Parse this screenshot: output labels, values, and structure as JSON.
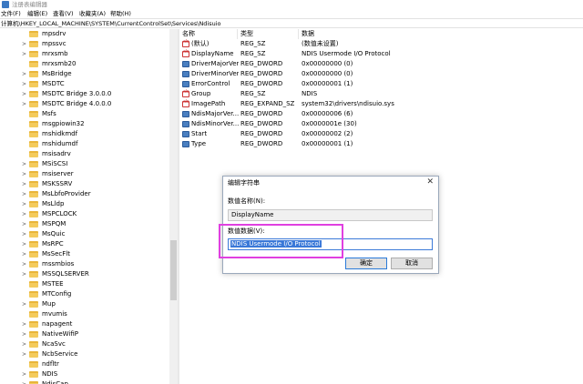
{
  "window": {
    "title": "注册表编辑器"
  },
  "menu": [
    "文件(F)",
    "编辑(E)",
    "查看(V)",
    "收藏夹(A)",
    "帮助(H)"
  ],
  "address": "计算机\\HKEY_LOCAL_MACHINE\\SYSTEM\\CurrentControlSet\\Services\\Ndisuio",
  "tree": {
    "items": [
      {
        "label": "mpsdrv",
        "arrow": ""
      },
      {
        "label": "mpssvc",
        "arrow": ">"
      },
      {
        "label": "mrxsmb",
        "arrow": ">"
      },
      {
        "label": "mrxsmb20",
        "arrow": ""
      },
      {
        "label": "MsBridge",
        "arrow": ">"
      },
      {
        "label": "MSDTC",
        "arrow": ">"
      },
      {
        "label": "MSDTC Bridge 3.0.0.0",
        "arrow": ">"
      },
      {
        "label": "MSDTC Bridge 4.0.0.0",
        "arrow": ">"
      },
      {
        "label": "Msfs",
        "arrow": ""
      },
      {
        "label": "msgpiowin32",
        "arrow": ""
      },
      {
        "label": "mshidkmdf",
        "arrow": ""
      },
      {
        "label": "mshidumdf",
        "arrow": ""
      },
      {
        "label": "msisadrv",
        "arrow": ""
      },
      {
        "label": "MSiSCSI",
        "arrow": ">"
      },
      {
        "label": "msiserver",
        "arrow": ">"
      },
      {
        "label": "MSKSSRV",
        "arrow": ">"
      },
      {
        "label": "MsLbfoProvider",
        "arrow": ">"
      },
      {
        "label": "MsLldp",
        "arrow": ">"
      },
      {
        "label": "MSPCLOCK",
        "arrow": ">"
      },
      {
        "label": "MSPQM",
        "arrow": ">"
      },
      {
        "label": "MsQuic",
        "arrow": ">"
      },
      {
        "label": "MsRPC",
        "arrow": ">"
      },
      {
        "label": "MsSecFlt",
        "arrow": ">"
      },
      {
        "label": "mssmbios",
        "arrow": ">"
      },
      {
        "label": "MSSQLSERVER",
        "arrow": ">"
      },
      {
        "label": "MSTEE",
        "arrow": ""
      },
      {
        "label": "MTConfig",
        "arrow": ""
      },
      {
        "label": "Mup",
        "arrow": ">"
      },
      {
        "label": "mvumis",
        "arrow": ""
      },
      {
        "label": "napagent",
        "arrow": ">"
      },
      {
        "label": "NativeWifiP",
        "arrow": ">"
      },
      {
        "label": "NcaSvc",
        "arrow": ">"
      },
      {
        "label": "NcbService",
        "arrow": ">"
      },
      {
        "label": "ndfltr",
        "arrow": ""
      },
      {
        "label": "NDIS",
        "arrow": ">"
      },
      {
        "label": "NdisCap",
        "arrow": ">"
      }
    ]
  },
  "list": {
    "headers": {
      "name": "名称",
      "type": "类型",
      "data": "数据"
    },
    "rows": [
      {
        "icon": "string-value-icon",
        "kind": "sz",
        "name": "(默认)",
        "type": "REG_SZ",
        "data": "(数值未设置)"
      },
      {
        "icon": "string-value-icon",
        "kind": "sz",
        "name": "DisplayName",
        "type": "REG_SZ",
        "data": "NDIS Usermode I/O Protocol"
      },
      {
        "icon": "binary-value-icon",
        "kind": "dw",
        "name": "DriverMajorVer...",
        "type": "REG_DWORD",
        "data": "0x00000000 (0)"
      },
      {
        "icon": "binary-value-icon",
        "kind": "dw",
        "name": "DriverMinorVer...",
        "type": "REG_DWORD",
        "data": "0x00000000 (0)"
      },
      {
        "icon": "binary-value-icon",
        "kind": "dw",
        "name": "ErrorControl",
        "type": "REG_DWORD",
        "data": "0x00000001 (1)"
      },
      {
        "icon": "string-value-icon",
        "kind": "sz",
        "name": "Group",
        "type": "REG_SZ",
        "data": "NDIS"
      },
      {
        "icon": "string-value-icon",
        "kind": "sz",
        "name": "ImagePath",
        "type": "REG_EXPAND_SZ",
        "data": "system32\\drivers\\ndisuio.sys"
      },
      {
        "icon": "binary-value-icon",
        "kind": "dw",
        "name": "NdisMajorVer...",
        "type": "REG_DWORD",
        "data": "0x00000006 (6)"
      },
      {
        "icon": "binary-value-icon",
        "kind": "dw",
        "name": "NdisMinorVer...",
        "type": "REG_DWORD",
        "data": "0x0000001e (30)"
      },
      {
        "icon": "binary-value-icon",
        "kind": "dw",
        "name": "Start",
        "type": "REG_DWORD",
        "data": "0x00000002 (2)"
      },
      {
        "icon": "binary-value-icon",
        "kind": "dw",
        "name": "Type",
        "type": "REG_DWORD",
        "data": "0x00000001 (1)"
      }
    ]
  },
  "dialog": {
    "title": "编辑字符串",
    "name_label": "数值名称(N):",
    "name_value": "DisplayName",
    "data_label": "数值数据(V):",
    "data_value": "NDIS Usermode I/O Protocol",
    "ok_label": "确定",
    "cancel_label": "取消"
  },
  "colors": {
    "highlight": "#e040e0",
    "selection": "#3a78d8"
  }
}
